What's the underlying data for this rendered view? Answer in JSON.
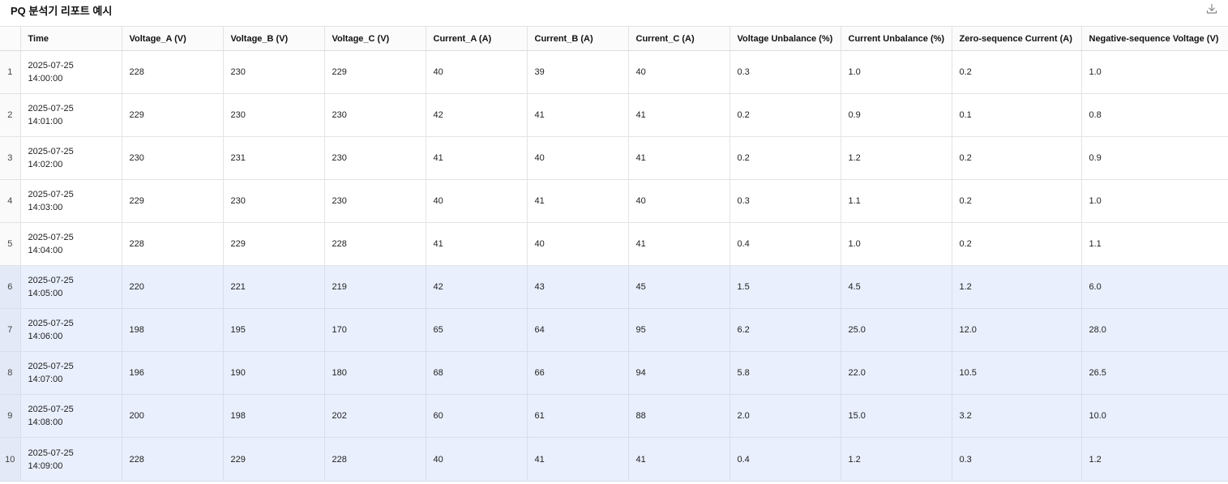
{
  "title": "PQ 분석기 리포트 예시",
  "download_icon": "download-icon",
  "colors": {
    "highlight_row": "#e9effc",
    "border": "#e3e3e3"
  },
  "columns": [
    "",
    "Time",
    "Voltage_A (V)",
    "Voltage_B (V)",
    "Voltage_C (V)",
    "Current_A (A)",
    "Current_B (A)",
    "Current_C (A)",
    "Voltage Unbalance (%)",
    "Current Unbalance (%)",
    "Zero-sequence Current (A)",
    "Negative-sequence Voltage (V)"
  ],
  "rows": [
    {
      "index": "1",
      "date": "2025-07-25",
      "time": "14:00:00",
      "values": [
        "228",
        "230",
        "229",
        "40",
        "39",
        "40",
        "0.3",
        "1.0",
        "0.2",
        "1.0"
      ],
      "highlight": false
    },
    {
      "index": "2",
      "date": "2025-07-25",
      "time": "14:01:00",
      "values": [
        "229",
        "230",
        "230",
        "42",
        "41",
        "41",
        "0.2",
        "0.9",
        "0.1",
        "0.8"
      ],
      "highlight": false
    },
    {
      "index": "3",
      "date": "2025-07-25",
      "time": "14:02:00",
      "values": [
        "230",
        "231",
        "230",
        "41",
        "40",
        "41",
        "0.2",
        "1.2",
        "0.2",
        "0.9"
      ],
      "highlight": false
    },
    {
      "index": "4",
      "date": "2025-07-25",
      "time": "14:03:00",
      "values": [
        "229",
        "230",
        "230",
        "40",
        "41",
        "40",
        "0.3",
        "1.1",
        "0.2",
        "1.0"
      ],
      "highlight": false
    },
    {
      "index": "5",
      "date": "2025-07-25",
      "time": "14:04:00",
      "values": [
        "228",
        "229",
        "228",
        "41",
        "40",
        "41",
        "0.4",
        "1.0",
        "0.2",
        "1.1"
      ],
      "highlight": false
    },
    {
      "index": "6",
      "date": "2025-07-25",
      "time": "14:05:00",
      "values": [
        "220",
        "221",
        "219",
        "42",
        "43",
        "45",
        "1.5",
        "4.5",
        "1.2",
        "6.0"
      ],
      "highlight": true
    },
    {
      "index": "7",
      "date": "2025-07-25",
      "time": "14:06:00",
      "values": [
        "198",
        "195",
        "170",
        "65",
        "64",
        "95",
        "6.2",
        "25.0",
        "12.0",
        "28.0"
      ],
      "highlight": true
    },
    {
      "index": "8",
      "date": "2025-07-25",
      "time": "14:07:00",
      "values": [
        "196",
        "190",
        "180",
        "68",
        "66",
        "94",
        "5.8",
        "22.0",
        "10.5",
        "26.5"
      ],
      "highlight": true
    },
    {
      "index": "9",
      "date": "2025-07-25",
      "time": "14:08:00",
      "values": [
        "200",
        "198",
        "202",
        "60",
        "61",
        "88",
        "2.0",
        "15.0",
        "3.2",
        "10.0"
      ],
      "highlight": true
    },
    {
      "index": "10",
      "date": "2025-07-25",
      "time": "14:09:00",
      "values": [
        "228",
        "229",
        "228",
        "40",
        "41",
        "41",
        "0.4",
        "1.2",
        "0.3",
        "1.2"
      ],
      "highlight": true
    }
  ]
}
